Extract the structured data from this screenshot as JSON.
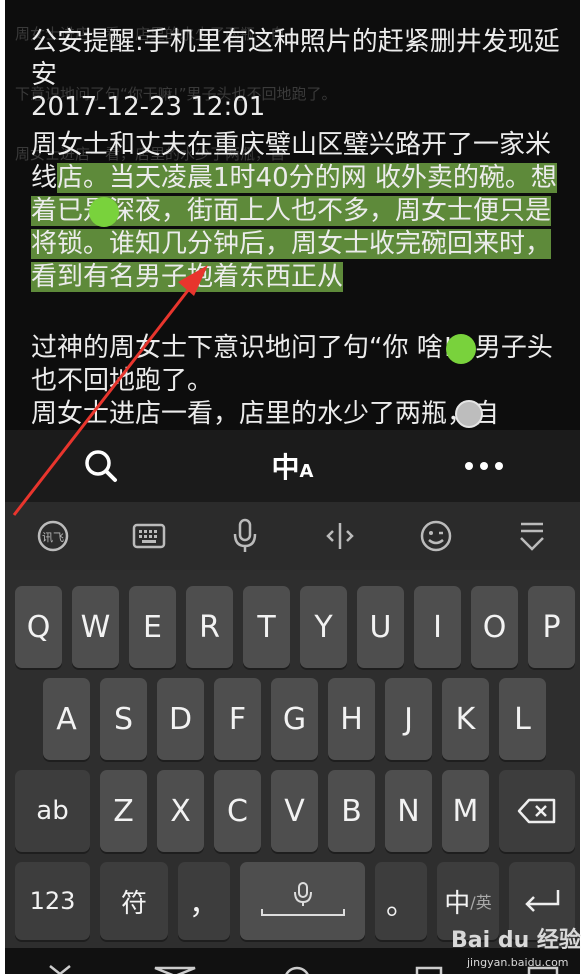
{
  "article": {
    "title": "公安提醒:手机里有这种照片的赶紧删井发现延安",
    "date": "2017-12-23 12:01",
    "body_before": "周女士和丈夫在重庆璧山区璧兴路开了一家米线",
    "body_selected": "店。当天凌晨1时40分的网 收外卖的碗。想着已是深夜，街面上人也不多，周女士便只是将锁。谁知几分钟后，周女士收完碗回来时，看到有名男子抱着东西正从",
    "body_after": "过神的周女士下意识地问了句“你 啥!” 男子头也不回地跑了。",
    "body_next": "周女士进店一看，店里的水少了两瓶，自",
    "ghost_lines": [
      "周女士进店一看，店里的水少了两瓶，自",
      "下意识地问了句“你干嘛!”男子头也不回地跑了。",
      "周女士进店一看，店里的水少了两瓶，自"
    ]
  },
  "edit_toolbar": {
    "search_icon": "search-icon",
    "translate_label": "中",
    "translate_sub": "A",
    "more_icon": "more-icon"
  },
  "ime_toolbar": {
    "logo_label": "讯飞",
    "items": [
      "keyboard-icon",
      "microphone-icon",
      "cursor-icon",
      "emoji-icon",
      "collapse-icon"
    ]
  },
  "keyboard": {
    "row1": [
      "Q",
      "W",
      "E",
      "R",
      "T",
      "Y",
      "U",
      "I",
      "O",
      "P"
    ],
    "row2": [
      "A",
      "S",
      "D",
      "F",
      "G",
      "H",
      "J",
      "K",
      "L"
    ],
    "row3_left": "ab",
    "row3": [
      "Z",
      "X",
      "C",
      "V",
      "B",
      "N",
      "M"
    ],
    "backspace_icon": "backspace-icon",
    "row4": {
      "num": "123",
      "symbol": "符",
      "comma": "，",
      "space_icon": "microphone-icon",
      "period": "。",
      "lang_main": "中",
      "lang_sub": "/英",
      "enter_icon": "enter-icon"
    }
  },
  "watermark": {
    "brand": "Bai du 经验",
    "site": "jingyan.baidu.com"
  },
  "colors": {
    "selection": "#5e8a3a",
    "handle": "#79d23c",
    "key": "#4e4e4e",
    "arrow": "#e8352d"
  }
}
